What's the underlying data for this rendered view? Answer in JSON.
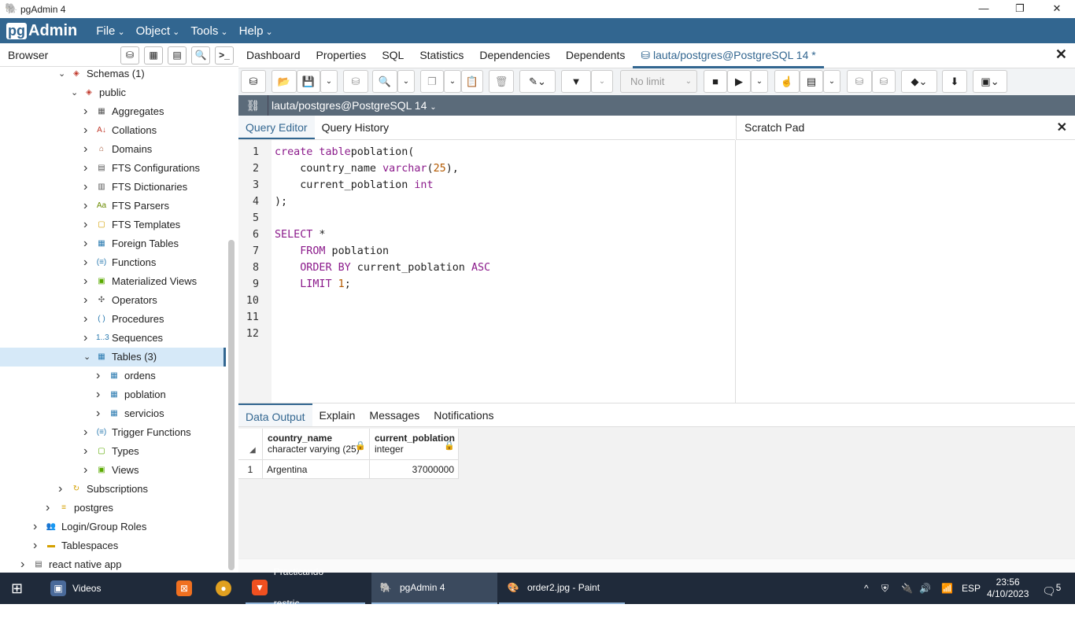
{
  "window": {
    "title": "pgAdmin 4",
    "minimize": "—",
    "maximize": "❐",
    "close": "✕"
  },
  "menubar": {
    "logo_pg": "pg",
    "logo_admin": "Admin",
    "items": [
      "File",
      "Object",
      "Tools",
      "Help"
    ]
  },
  "browser": {
    "title": "Browser"
  },
  "tree": [
    {
      "label": "Schemas (1)",
      "level": 2,
      "icon": "schemas-icon",
      "glyph": "◈",
      "color": "#c0392b",
      "chev": "⌄"
    },
    {
      "label": "public",
      "level": 3,
      "icon": "schema-icon",
      "glyph": "◈",
      "color": "#c0392b",
      "chev": "⌄"
    },
    {
      "label": "Aggregates",
      "level": 4,
      "icon": "aggregates-icon",
      "glyph": "▦",
      "color": "#555",
      "chev": "›"
    },
    {
      "label": "Collations",
      "level": 4,
      "icon": "collations-icon",
      "glyph": "A↓",
      "color": "#c0392b",
      "chev": "›"
    },
    {
      "label": "Domains",
      "level": 4,
      "icon": "domains-icon",
      "glyph": "⌂",
      "color": "#a05030",
      "chev": "›"
    },
    {
      "label": "FTS Configurations",
      "level": 4,
      "icon": "fts-configurations-icon",
      "glyph": "▤",
      "color": "#555",
      "chev": "›"
    },
    {
      "label": "FTS Dictionaries",
      "level": 4,
      "icon": "fts-dictionaries-icon",
      "glyph": "▥",
      "color": "#555",
      "chev": "›"
    },
    {
      "label": "FTS Parsers",
      "level": 4,
      "icon": "fts-parsers-icon",
      "glyph": "Aa",
      "color": "#6a8a00",
      "chev": "›"
    },
    {
      "label": "FTS Templates",
      "level": 4,
      "icon": "fts-templates-icon",
      "glyph": "▢",
      "color": "#d4a000",
      "chev": "›"
    },
    {
      "label": "Foreign Tables",
      "level": 4,
      "icon": "foreign-tables-icon",
      "glyph": "▦",
      "color": "#2a7ab0",
      "chev": "›"
    },
    {
      "label": "Functions",
      "level": 4,
      "icon": "functions-icon",
      "glyph": "(≡)",
      "color": "#2a7ab0",
      "chev": "›"
    },
    {
      "label": "Materialized Views",
      "level": 4,
      "icon": "materialized-views-icon",
      "glyph": "▣",
      "color": "#5aaa00",
      "chev": "›"
    },
    {
      "label": "Operators",
      "level": 4,
      "icon": "operators-icon",
      "glyph": "✣",
      "color": "#555",
      "chev": "›"
    },
    {
      "label": "Procedures",
      "level": 4,
      "icon": "procedures-icon",
      "glyph": "( )",
      "color": "#2a7ab0",
      "chev": "›"
    },
    {
      "label": "Sequences",
      "level": 4,
      "icon": "sequences-icon",
      "glyph": "1..3",
      "color": "#2a7ab0",
      "chev": "›"
    },
    {
      "label": "Tables (3)",
      "level": 4,
      "icon": "tables-icon",
      "glyph": "▦",
      "color": "#2a7ab0",
      "chev": "⌄",
      "selected": true
    },
    {
      "label": "ordens",
      "level": 5,
      "icon": "table-icon",
      "glyph": "▦",
      "color": "#2a7ab0",
      "chev": "›"
    },
    {
      "label": "poblation",
      "level": 5,
      "icon": "table-icon",
      "glyph": "▦",
      "color": "#2a7ab0",
      "chev": "›"
    },
    {
      "label": "servicios",
      "level": 5,
      "icon": "table-icon",
      "glyph": "▦",
      "color": "#2a7ab0",
      "chev": "›"
    },
    {
      "label": "Trigger Functions",
      "level": 4,
      "icon": "trigger-functions-icon",
      "glyph": "(≡)",
      "color": "#2a7ab0",
      "chev": "›"
    },
    {
      "label": "Types",
      "level": 4,
      "icon": "types-icon",
      "glyph": "▢",
      "color": "#5aaa00",
      "chev": "›"
    },
    {
      "label": "Views",
      "level": 4,
      "icon": "views-icon",
      "glyph": "▣",
      "color": "#5aaa00",
      "chev": "›"
    },
    {
      "label": "Subscriptions",
      "level": 2,
      "icon": "subscriptions-icon",
      "glyph": "↻",
      "color": "#d4a000",
      "chev": "›"
    },
    {
      "label": "postgres",
      "level": 1,
      "icon": "database-icon",
      "glyph": "≡",
      "color": "#d4a000",
      "chev": "›"
    },
    {
      "label": "Login/Group Roles",
      "level": 0,
      "icon": "roles-icon",
      "glyph": "👥",
      "color": "#c0392b",
      "chev": "›"
    },
    {
      "label": "Tablespaces",
      "level": 0,
      "icon": "tablespaces-icon",
      "glyph": "▬",
      "color": "#d4a000",
      "chev": "›"
    },
    {
      "label": "react native app",
      "level": -1,
      "icon": "server-disconnected-icon",
      "glyph": "▤",
      "color": "#555",
      "chev": "›"
    }
  ],
  "main_tabs": [
    "Dashboard",
    "Properties",
    "SQL",
    "Statistics",
    "Dependencies",
    "Dependents",
    "lauta/postgres@PostgreSQL 14 *"
  ],
  "toolbar": {
    "limit": "No limit"
  },
  "connection": {
    "label": "lauta/postgres@PostgreSQL 14"
  },
  "editor_tabs": [
    "Query Editor",
    "Query History"
  ],
  "scratch": {
    "title": "Scratch Pad",
    "close": "✕"
  },
  "code": [
    [
      [
        "kw",
        "create table"
      ],
      [
        "",
        "poblation("
      ]
    ],
    [
      [
        "",
        "    country_name "
      ],
      [
        "kw",
        "varchar"
      ],
      [
        "",
        "("
      ],
      [
        "num",
        "25"
      ],
      [
        "",
        "),"
      ]
    ],
    [
      [
        "",
        "    current_poblation "
      ],
      [
        "kw",
        "int"
      ]
    ],
    [
      [
        "",
        ");"
      ]
    ],
    [],
    [
      [
        "kw",
        "SELECT"
      ],
      [
        "",
        " *"
      ]
    ],
    [
      [
        "",
        "    "
      ],
      [
        "kw",
        "FROM"
      ],
      [
        "",
        " poblation"
      ]
    ],
    [
      [
        "",
        "    "
      ],
      [
        "kw",
        "ORDER BY"
      ],
      [
        "",
        " current_poblation "
      ],
      [
        "kw",
        "ASC"
      ]
    ],
    [
      [
        "",
        "    "
      ],
      [
        "kw",
        "LIMIT"
      ],
      [
        "",
        " "
      ],
      [
        "num",
        "1"
      ],
      [
        "",
        ";"
      ]
    ],
    [],
    [],
    []
  ],
  "output_tabs": [
    "Data Output",
    "Explain",
    "Messages",
    "Notifications"
  ],
  "grid": {
    "columns": [
      {
        "name": "country_name",
        "type": "character varying (25)"
      },
      {
        "name": "current_poblation",
        "type": "integer"
      }
    ],
    "rows": [
      {
        "n": "1",
        "values": [
          "Argentina",
          "37000000"
        ]
      }
    ]
  },
  "taskbar": {
    "items": [
      "Videos",
      "Practicando restric...",
      "pgAdmin 4",
      "order2.jpg - Paint"
    ],
    "lang": "ESP",
    "time": "23:56",
    "date": "4/10/2023",
    "notifications": "5"
  }
}
